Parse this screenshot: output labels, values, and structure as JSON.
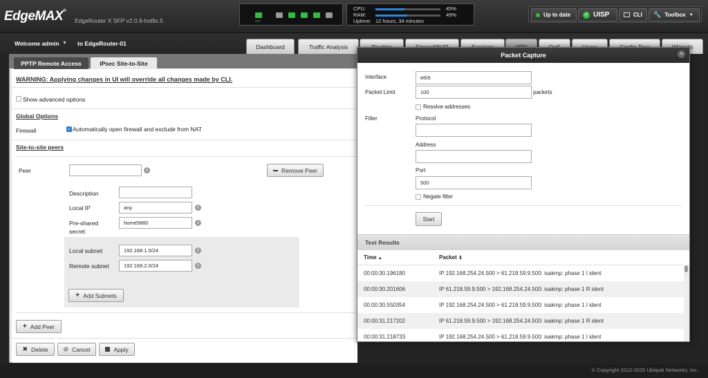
{
  "header": {
    "logo": "EdgeMAX",
    "logo_mark": "®",
    "version": "EdgeRouter X SFP v2.0.9-hotfix.5",
    "ports_label": "SFP",
    "stats": [
      {
        "label": "CPU:",
        "value": "45%",
        "level": 0.45
      },
      {
        "label": "RAM:",
        "value": "49%",
        "level": 0.49
      },
      {
        "label": "Uptime:",
        "value": "12 hours, 34 minutes"
      }
    ],
    "up_to_date": "Up to date",
    "uisp": "UISP",
    "cli": "CLI",
    "toolbox": "Toolbox"
  },
  "user": {
    "welcome": "Welcome admin",
    "router": "to EdgeRouter-01"
  },
  "nav_tabs": [
    "Dashboard",
    "Traffic Analysis",
    "Routing",
    "Firewall/NAT",
    "Services",
    "VPN",
    "QoS",
    "Users",
    "Config Tree",
    "Wizards"
  ],
  "vpn_tabs": [
    "PPTP Remote Access",
    "IPsec Site-to-Site"
  ],
  "ipsec": {
    "warning": "WARNING: Applying changes in UI will override all changes made by CLI.",
    "show_advanced": "Show advanced options",
    "global_options": "Global Options",
    "firewall_label": "Firewall",
    "firewall_option": "Automatically open firewall and exclude from NAT",
    "site_peers": "Site-to-site peers",
    "peer_label": "Peer",
    "peer_value": "",
    "remove_peer": "Remove Peer",
    "description_label": "Description",
    "description_value": "",
    "local_ip_label": "Local IP",
    "local_ip_value": "any",
    "psk_label_1": "Pre-shared",
    "psk_label_2": "secret",
    "psk_value": "home5860",
    "local_subnet_label": "Local subnet",
    "local_subnet_value": "192.168.1.0/24",
    "remote_subnet_label": "Remote subnet",
    "remote_subnet_value": "192.168.2.0/24",
    "add_subnets": "Add Subnets",
    "add_peer": "Add Peer",
    "delete": "Delete",
    "cancel": "Cancel",
    "apply": "Apply"
  },
  "capture": {
    "title": "Packet Capture",
    "interface_label": "Interface",
    "interface_value": "eth5",
    "packet_limit_label": "Packet Limit",
    "packet_limit_value": "100",
    "packets_unit": "packets",
    "resolve": "Resolve addresses",
    "filter_label": "Filter",
    "protocol_label": "Protocol",
    "protocol_value": "",
    "address_label": "Address",
    "address_value": "",
    "port_label": "Port",
    "port_value": "500",
    "negate": "Negate filter",
    "start": "Start",
    "results_title": "Test Results",
    "col_time": "Time",
    "col_packet": "Packet",
    "rows": [
      {
        "time": "00:00:30.196180",
        "packet": "IP 192.168.254.24.500 > 61.218.59.9.500: isakmp: phase 1 I ident"
      },
      {
        "time": "00:00:30.201606",
        "packet": "IP 61.218.59.9.500 > 192.168.254.24.500: isakmp: phase 1 R ident"
      },
      {
        "time": "00:00:30.550354",
        "packet": "IP 192.168.254.24.500 > 61.218.59.9.500: isakmp: phase 1 I ident"
      },
      {
        "time": "00:00:31.217202",
        "packet": "IP 61.218.59.9.500 > 192.168.254.24.500: isakmp: phase 1 R ident"
      },
      {
        "time": "00:00:31.218733",
        "packet": "IP 192.168.254.24.500 > 61.218.59.9.500: isakmp: phase 1 I ident"
      }
    ]
  },
  "footer": {
    "copyright": "© Copyright 2012-2020 Ubiquiti Networks, Inc."
  }
}
